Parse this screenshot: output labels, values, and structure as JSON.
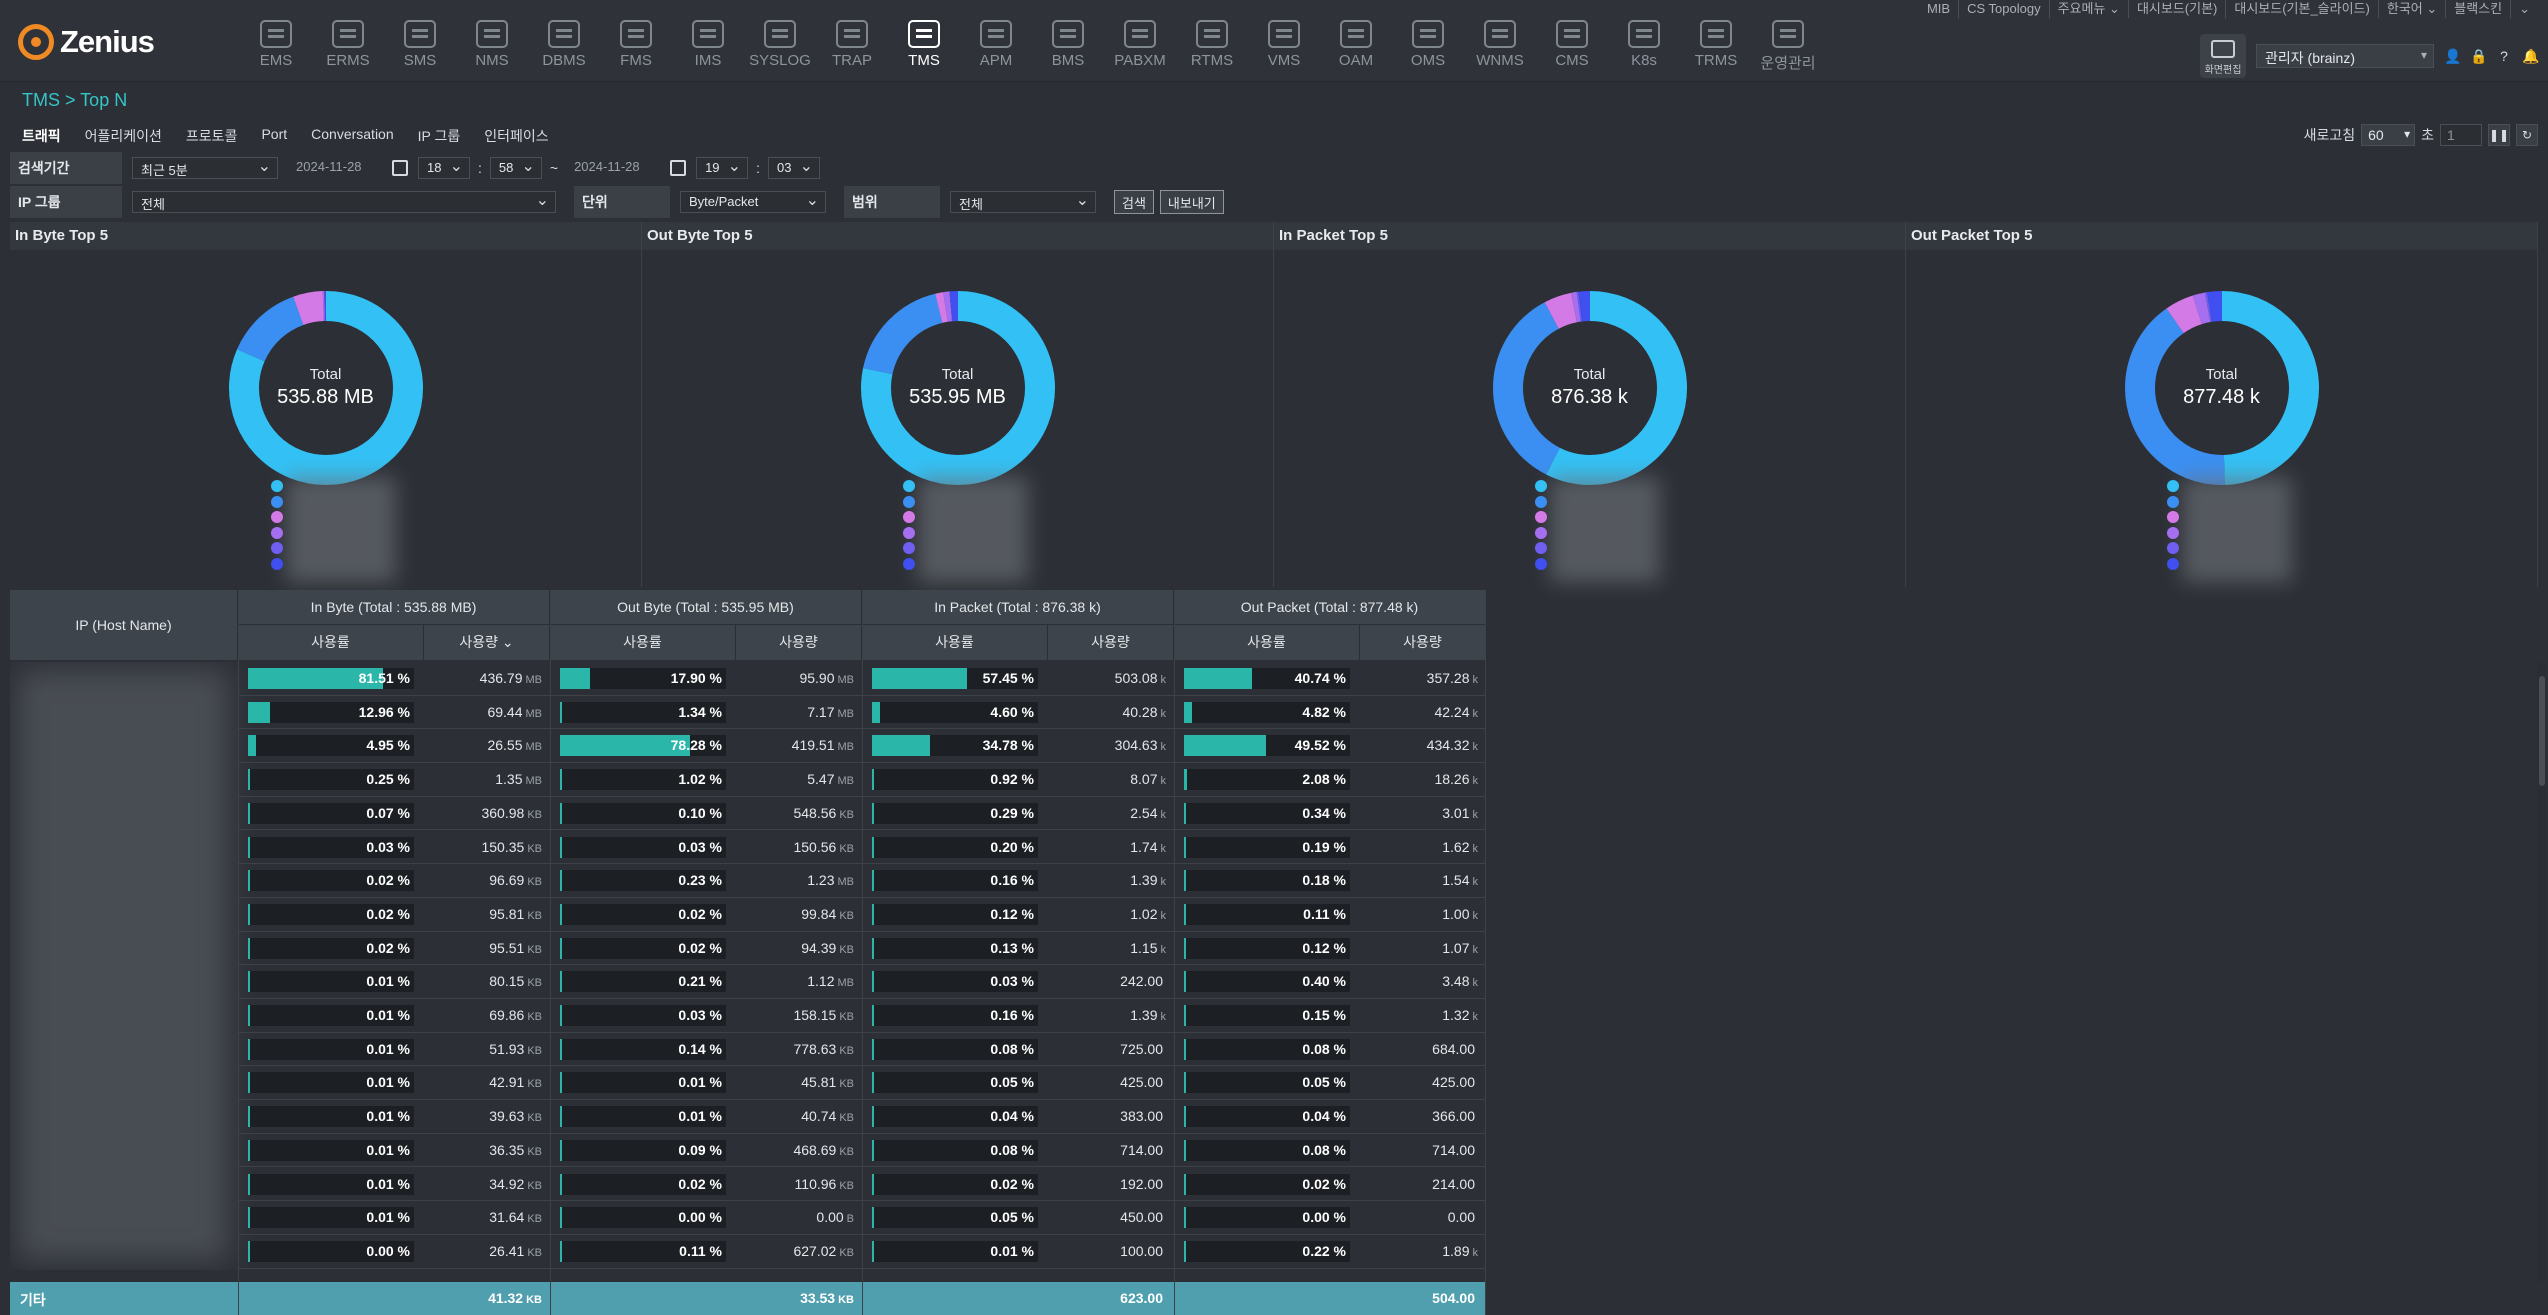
{
  "logo": "Zenius",
  "nav": [
    "EMS",
    "ERMS",
    "SMS",
    "NMS",
    "DBMS",
    "FMS",
    "IMS",
    "SYSLOG",
    "TRAP",
    "TMS",
    "APM",
    "BMS",
    "PABXM",
    "RTMS",
    "VMS",
    "OAM",
    "OMS",
    "WNMS",
    "CMS",
    "K8s",
    "TRMS",
    "운영관리"
  ],
  "nav_active": "TMS",
  "top_links": [
    "MIB",
    "CS Topology",
    "주요메뉴 ⌄",
    "대시보드(기본)",
    "대시보드(기본_슬라이드)",
    "한국어 ⌄",
    "블랙스킨",
    "⌄"
  ],
  "user": {
    "screen_btn": "화면편집",
    "select": "관리자 (brainz)"
  },
  "breadcrumb": "TMS > Top N",
  "tabs": [
    "트래픽",
    "어플리케이션",
    "프로토콜",
    "Port",
    "Conversation",
    "IP 그룹",
    "인터페이스"
  ],
  "refresh": {
    "label": "새로고침",
    "value": "60",
    "unit": "초",
    "page": "1"
  },
  "filter1": {
    "label": "검색기간",
    "period": "최근 5분",
    "from_date": "2024-11-28",
    "from_h": "18",
    "from_m": "58",
    "tilde": "~",
    "to_date": "2024-11-28",
    "to_h": "19",
    "to_m": "03"
  },
  "filter2": {
    "ipgroup_label": "IP 그룹",
    "ipgroup": "전체",
    "unit_label": "단위",
    "unit": "Byte/Packet",
    "range_label": "범위",
    "range": "전체",
    "search_btn": "검색",
    "export_btn": "내보내기"
  },
  "panels": [
    {
      "title": "In Byte Top 5",
      "total_label": "Total",
      "total": "535.88 MB"
    },
    {
      "title": "Out Byte Top 5",
      "total_label": "Total",
      "total": "535.95 MB"
    },
    {
      "title": "In Packet Top 5",
      "total_label": "Total",
      "total": "876.38 k"
    },
    {
      "title": "Out Packet Top 5",
      "total_label": "Total",
      "total": "877.48 k"
    }
  ],
  "chart_data": [
    {
      "type": "pie",
      "title": "In Byte Top 5",
      "values": [
        81.51,
        12.96,
        4.95,
        0.25,
        0.07,
        0.26
      ],
      "colors": [
        "#33c1f5",
        "#3b8ff2",
        "#d47ae6",
        "#a56ff0",
        "#6f5ef0",
        "#3f4ff0"
      ]
    },
    {
      "type": "pie",
      "title": "Out Byte Top 5",
      "values": [
        78.28,
        17.9,
        1.34,
        1.02,
        0.1,
        1.36
      ],
      "colors": [
        "#33c1f5",
        "#3b8ff2",
        "#d47ae6",
        "#a56ff0",
        "#6f5ef0",
        "#3f4ff0"
      ]
    },
    {
      "type": "pie",
      "title": "In Packet Top 5",
      "values": [
        57.45,
        34.78,
        4.6,
        0.92,
        0.29,
        1.96
      ],
      "colors": [
        "#33c1f5",
        "#3b8ff2",
        "#d47ae6",
        "#a56ff0",
        "#6f5ef0",
        "#3f4ff0"
      ]
    },
    {
      "type": "pie",
      "title": "Out Packet Top 5",
      "values": [
        49.52,
        40.74,
        4.82,
        2.08,
        0.34,
        2.5
      ],
      "colors": [
        "#33c1f5",
        "#3b8ff2",
        "#d47ae6",
        "#a56ff0",
        "#6f5ef0",
        "#3f4ff0"
      ]
    }
  ],
  "legend_colors": [
    "#33c1f5",
    "#3b8ff2",
    "#d47ae6",
    "#a56ff0",
    "#6f5ef0",
    "#3f4ff0"
  ],
  "table": {
    "ip_header": "IP (Host Name)",
    "groups": [
      "In Byte (Total : 535.88 MB)",
      "Out Byte (Total : 535.95 MB)",
      "In Packet (Total : 876.38 k)",
      "Out Packet (Total : 877.48 k)"
    ],
    "sub_headers": [
      "사용률",
      "사용량 ⌄",
      "사용률",
      "사용량",
      "사용률",
      "사용량",
      "사용률",
      "사용량"
    ],
    "rows": [
      {
        "c": [
          [
            81.51,
            "81.51 %"
          ],
          [
            "436.79",
            "MB"
          ],
          [
            17.9,
            "17.90 %"
          ],
          [
            "95.90",
            "MB"
          ],
          [
            57.45,
            "57.45 %"
          ],
          [
            "503.08",
            "k"
          ],
          [
            40.74,
            "40.74 %"
          ],
          [
            "357.28",
            "k"
          ]
        ]
      },
      {
        "c": [
          [
            12.96,
            "12.96 %"
          ],
          [
            "69.44",
            "MB"
          ],
          [
            1.34,
            "1.34 %"
          ],
          [
            "7.17",
            "MB"
          ],
          [
            4.6,
            "4.60 %"
          ],
          [
            "40.28",
            "k"
          ],
          [
            4.82,
            "4.82 %"
          ],
          [
            "42.24",
            "k"
          ]
        ]
      },
      {
        "c": [
          [
            4.95,
            "4.95 %"
          ],
          [
            "26.55",
            "MB"
          ],
          [
            78.28,
            "78.28 %"
          ],
          [
            "419.51",
            "MB"
          ],
          [
            34.78,
            "34.78 %"
          ],
          [
            "304.63",
            "k"
          ],
          [
            49.52,
            "49.52 %"
          ],
          [
            "434.32",
            "k"
          ]
        ]
      },
      {
        "c": [
          [
            0.25,
            "0.25 %"
          ],
          [
            "1.35",
            "MB"
          ],
          [
            1.02,
            "1.02 %"
          ],
          [
            "5.47",
            "MB"
          ],
          [
            0.92,
            "0.92 %"
          ],
          [
            "8.07",
            "k"
          ],
          [
            2.08,
            "2.08 %"
          ],
          [
            "18.26",
            "k"
          ]
        ]
      },
      {
        "c": [
          [
            0.07,
            "0.07 %"
          ],
          [
            "360.98",
            "KB"
          ],
          [
            0.1,
            "0.10 %"
          ],
          [
            "548.56",
            "KB"
          ],
          [
            0.29,
            "0.29 %"
          ],
          [
            "2.54",
            "k"
          ],
          [
            0.34,
            "0.34 %"
          ],
          [
            "3.01",
            "k"
          ]
        ]
      },
      {
        "c": [
          [
            0.03,
            "0.03 %"
          ],
          [
            "150.35",
            "KB"
          ],
          [
            0.03,
            "0.03 %"
          ],
          [
            "150.56",
            "KB"
          ],
          [
            0.2,
            "0.20 %"
          ],
          [
            "1.74",
            "k"
          ],
          [
            0.19,
            "0.19 %"
          ],
          [
            "1.62",
            "k"
          ]
        ]
      },
      {
        "c": [
          [
            0.02,
            "0.02 %"
          ],
          [
            "96.69",
            "KB"
          ],
          [
            0.23,
            "0.23 %"
          ],
          [
            "1.23",
            "MB"
          ],
          [
            0.16,
            "0.16 %"
          ],
          [
            "1.39",
            "k"
          ],
          [
            0.18,
            "0.18 %"
          ],
          [
            "1.54",
            "k"
          ]
        ]
      },
      {
        "c": [
          [
            0.02,
            "0.02 %"
          ],
          [
            "95.81",
            "KB"
          ],
          [
            0.02,
            "0.02 %"
          ],
          [
            "99.84",
            "KB"
          ],
          [
            0.12,
            "0.12 %"
          ],
          [
            "1.02",
            "k"
          ],
          [
            0.11,
            "0.11 %"
          ],
          [
            "1.00",
            "k"
          ]
        ]
      },
      {
        "c": [
          [
            0.02,
            "0.02 %"
          ],
          [
            "95.51",
            "KB"
          ],
          [
            0.02,
            "0.02 %"
          ],
          [
            "94.39",
            "KB"
          ],
          [
            0.13,
            "0.13 %"
          ],
          [
            "1.15",
            "k"
          ],
          [
            0.12,
            "0.12 %"
          ],
          [
            "1.07",
            "k"
          ]
        ]
      },
      {
        "c": [
          [
            0.01,
            "0.01 %"
          ],
          [
            "80.15",
            "KB"
          ],
          [
            0.21,
            "0.21 %"
          ],
          [
            "1.12",
            "MB"
          ],
          [
            0.03,
            "0.03 %"
          ],
          [
            "242.00",
            ""
          ],
          [
            0.4,
            "0.40 %"
          ],
          [
            "3.48",
            "k"
          ]
        ]
      },
      {
        "c": [
          [
            0.01,
            "0.01 %"
          ],
          [
            "69.86",
            "KB"
          ],
          [
            0.03,
            "0.03 %"
          ],
          [
            "158.15",
            "KB"
          ],
          [
            0.16,
            "0.16 %"
          ],
          [
            "1.39",
            "k"
          ],
          [
            0.15,
            "0.15 %"
          ],
          [
            "1.32",
            "k"
          ]
        ]
      },
      {
        "c": [
          [
            0.01,
            "0.01 %"
          ],
          [
            "51.93",
            "KB"
          ],
          [
            0.14,
            "0.14 %"
          ],
          [
            "778.63",
            "KB"
          ],
          [
            0.08,
            "0.08 %"
          ],
          [
            "725.00",
            ""
          ],
          [
            0.08,
            "0.08 %"
          ],
          [
            "684.00",
            ""
          ]
        ]
      },
      {
        "c": [
          [
            0.01,
            "0.01 %"
          ],
          [
            "42.91",
            "KB"
          ],
          [
            0.01,
            "0.01 %"
          ],
          [
            "45.81",
            "KB"
          ],
          [
            0.05,
            "0.05 %"
          ],
          [
            "425.00",
            ""
          ],
          [
            0.05,
            "0.05 %"
          ],
          [
            "425.00",
            ""
          ]
        ]
      },
      {
        "c": [
          [
            0.01,
            "0.01 %"
          ],
          [
            "39.63",
            "KB"
          ],
          [
            0.01,
            "0.01 %"
          ],
          [
            "40.74",
            "KB"
          ],
          [
            0.04,
            "0.04 %"
          ],
          [
            "383.00",
            ""
          ],
          [
            0.04,
            "0.04 %"
          ],
          [
            "366.00",
            ""
          ]
        ]
      },
      {
        "c": [
          [
            0.01,
            "0.01 %"
          ],
          [
            "36.35",
            "KB"
          ],
          [
            0.09,
            "0.09 %"
          ],
          [
            "468.69",
            "KB"
          ],
          [
            0.08,
            "0.08 %"
          ],
          [
            "714.00",
            ""
          ],
          [
            0.08,
            "0.08 %"
          ],
          [
            "714.00",
            ""
          ]
        ]
      },
      {
        "c": [
          [
            0.01,
            "0.01 %"
          ],
          [
            "34.92",
            "KB"
          ],
          [
            0.02,
            "0.02 %"
          ],
          [
            "110.96",
            "KB"
          ],
          [
            0.02,
            "0.02 %"
          ],
          [
            "192.00",
            ""
          ],
          [
            0.02,
            "0.02 %"
          ],
          [
            "214.00",
            ""
          ]
        ]
      },
      {
        "c": [
          [
            0.01,
            "0.01 %"
          ],
          [
            "31.64",
            "KB"
          ],
          [
            0.0,
            "0.00 %"
          ],
          [
            "0.00",
            "B"
          ],
          [
            0.05,
            "0.05 %"
          ],
          [
            "450.00",
            ""
          ],
          [
            0.0,
            "0.00 %"
          ],
          [
            "0.00",
            ""
          ]
        ]
      },
      {
        "c": [
          [
            0.0,
            "0.00 %"
          ],
          [
            "26.41",
            "KB"
          ],
          [
            0.11,
            "0.11 %"
          ],
          [
            "627.02",
            "KB"
          ],
          [
            0.01,
            "0.01 %"
          ],
          [
            "100.00",
            ""
          ],
          [
            0.22,
            "0.22 %"
          ],
          [
            "1.89",
            "k"
          ]
        ]
      }
    ],
    "footer": {
      "label": "기타",
      "values": [
        [
          "41.32",
          "KB"
        ],
        [
          "33.53",
          "KB"
        ],
        [
          "623.00",
          ""
        ],
        [
          "504.00",
          ""
        ]
      ]
    }
  }
}
